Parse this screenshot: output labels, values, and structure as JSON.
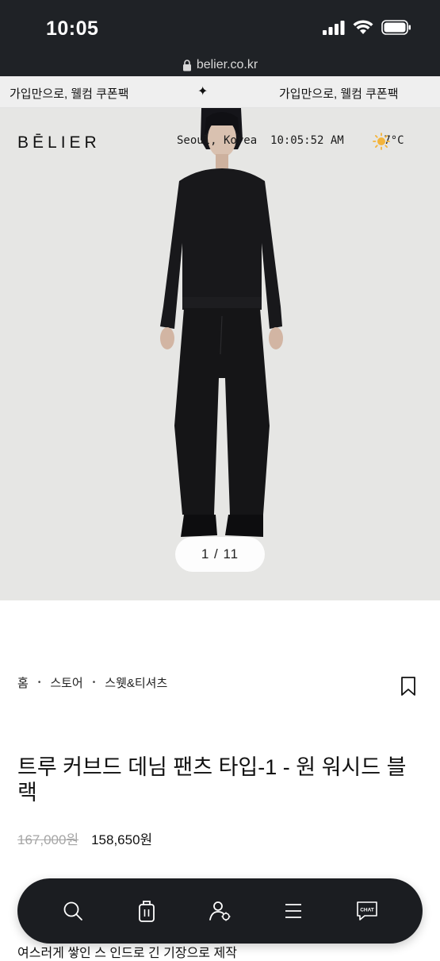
{
  "status_bar": {
    "time": "10:05",
    "url": "belier.co.kr"
  },
  "promo": {
    "text_left": "가입만으로, 웰컴 쿠폰팩",
    "separator": "✦",
    "text_right": "가입만으로, 웰컴 쿠폰팩"
  },
  "header": {
    "logo": "BĒLIER",
    "city": "Seoul, Korea",
    "clock": "10:05:52 AM",
    "weather_icon": "sun-icon",
    "temperature": "-7°C"
  },
  "gallery": {
    "pager": "1 / 11"
  },
  "breadcrumb": {
    "home": "홈",
    "store": "스토어",
    "category": "스웻&티셔츠"
  },
  "product": {
    "title": "트루 커브드 데님 팬츠 타입-1 - 원 워시드 블랙",
    "price_original": "167,000원",
    "price_sale": "158,650원",
    "description": "여스러게 쌓인 스 인드로 긴 기장으로 제작"
  },
  "bottom_nav": {
    "items": [
      "search-icon",
      "bag-icon",
      "user-icon",
      "menu-icon",
      "chat-icon"
    ],
    "chat_label": "CHAT"
  },
  "colors": {
    "status_bg": "#1f2226",
    "hero_bg": "#e6e6e4",
    "nav_bg": "#1b1d21",
    "old_price": "#a6a6a6"
  }
}
